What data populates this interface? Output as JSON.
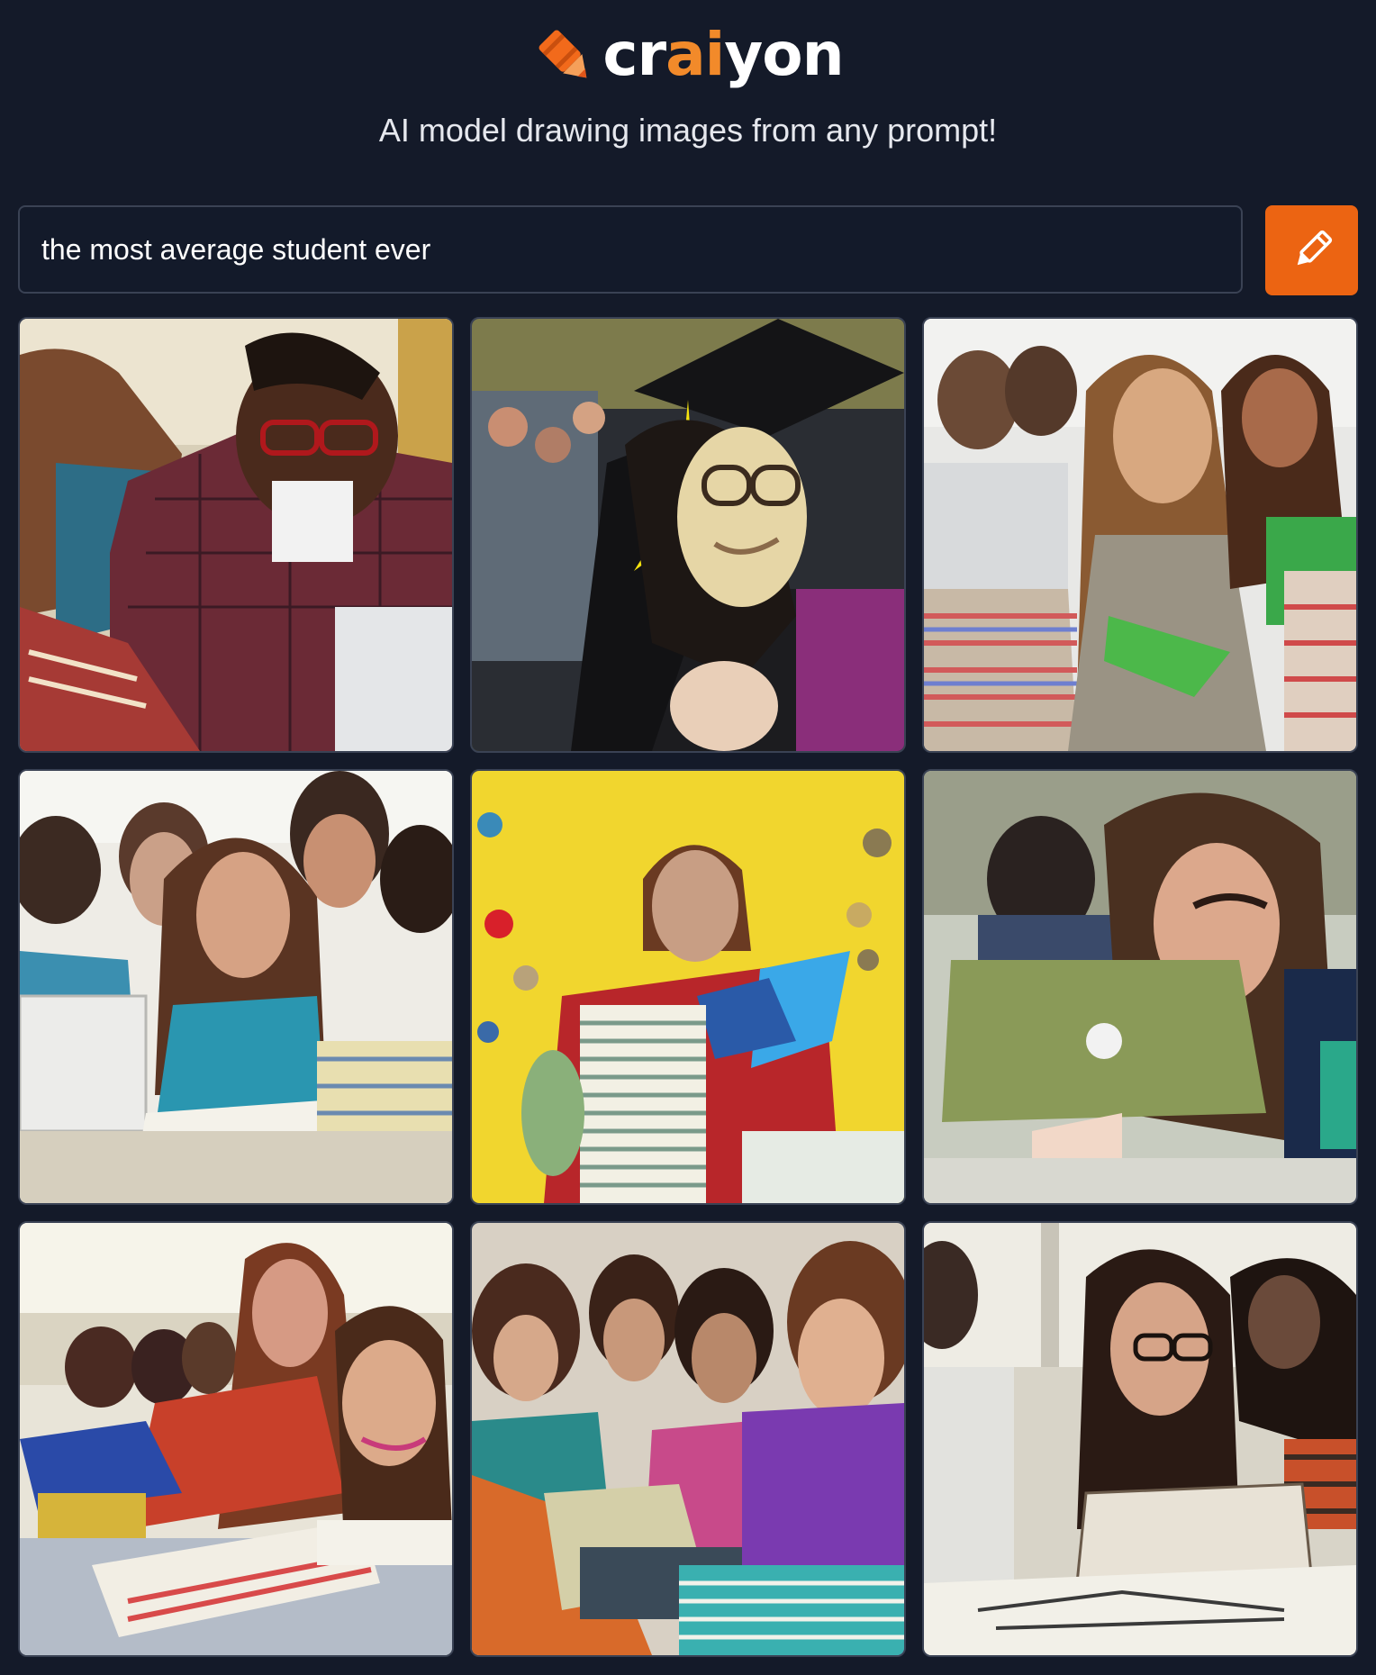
{
  "brand": {
    "pre": "cr",
    "accent": "ai",
    "post": "yon",
    "accent_color": "#f28a2a"
  },
  "tagline": "AI model drawing images from any prompt!",
  "search": {
    "value": "the most average student ever"
  },
  "draw_button": {
    "icon": "pencil-icon",
    "color": "#ec6412"
  },
  "images": [
    {
      "name": "generated-image-1",
      "label": "Student with glasses leaning over books"
    },
    {
      "name": "generated-image-2",
      "label": "Graduate in cap and gown"
    },
    {
      "name": "generated-image-3",
      "label": "Student holding green notebook by book stacks"
    },
    {
      "name": "generated-image-4",
      "label": "Group of students with laptop and books"
    },
    {
      "name": "generated-image-5",
      "label": "Student behind stack of books on yellow background"
    },
    {
      "name": "generated-image-6",
      "label": "Student behind green laptop"
    },
    {
      "name": "generated-image-7",
      "label": "Students reading books at a table"
    },
    {
      "name": "generated-image-8",
      "label": "Students with laptops and books"
    },
    {
      "name": "generated-image-9",
      "label": "Student reading a book in classroom"
    }
  ]
}
